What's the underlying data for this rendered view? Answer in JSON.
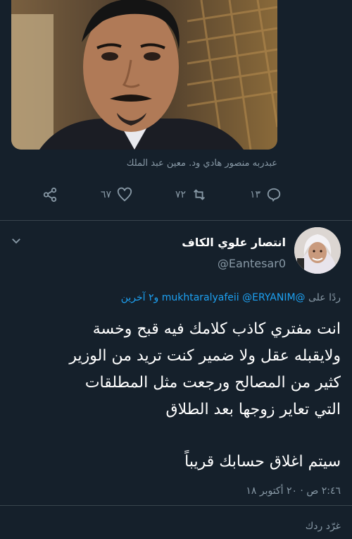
{
  "image_card": {
    "caption": "عبدربه منصور هادي ود. معين عبد الملك"
  },
  "actions": {
    "share_icon": "share-icon",
    "like_count": "٦٧",
    "retweet_count": "٧٢",
    "reply_count": "١٣"
  },
  "tweet": {
    "author_name": "انتصار علوي الكاف",
    "author_handle": "@Eantesar0",
    "reply_prefix": "ردًا على",
    "reply_mentions": "@mukhtaralyafeii @ERYANIM",
    "reply_more": "و٢ آخرين",
    "text_lines": [
      "انت مفتري كاذب كلامك فيه قبح وخسة",
      "ولايقبله عقل ولا ضمير كنت تريد من الوزير",
      "كثير من المصالح ورجعت مثل المطلقات",
      "التي تعاير زوجها بعد الطلاق"
    ],
    "last_line": "سيتم اغلاق حسابك قريباً",
    "timestamp": "٢:٤٦ ص · ٢٠ أكتوبر ١٨"
  },
  "composer": {
    "placeholder": "غرّد ردك"
  },
  "colors": {
    "background": "#15202b",
    "muted": "#8899a6",
    "accent": "#1da1f2",
    "divider": "#38444d"
  }
}
